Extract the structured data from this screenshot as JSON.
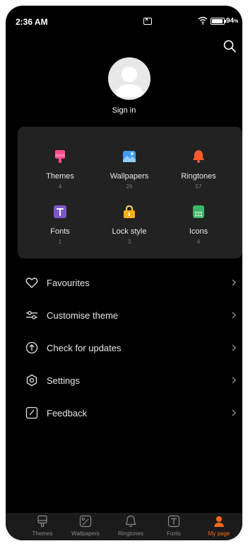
{
  "status_bar": {
    "time": "2:36 AM",
    "battery_percent": "94",
    "battery_unit": "%",
    "battery_level": 0.94
  },
  "header": {
    "search_icon": "search-icon"
  },
  "profile": {
    "avatar_icon": "user-avatar-icon",
    "sign_in_label": "Sign in"
  },
  "content_grid": [
    {
      "label": "Themes",
      "count": "4",
      "icon": "themes-icon",
      "color": "#ff4f8b"
    },
    {
      "label": "Wallpapers",
      "count": "26",
      "icon": "wallpapers-icon",
      "color": "#3f9ef0"
    },
    {
      "label": "Ringtones",
      "count": "57",
      "icon": "ringtones-icon",
      "color": "#ff5a28"
    },
    {
      "label": "Fonts",
      "count": "1",
      "icon": "fonts-icon",
      "color": "#7b57c8"
    },
    {
      "label": "Lock style",
      "count": "3",
      "icon": "lock-style-icon",
      "color": "#ffae1a"
    },
    {
      "label": "Icons",
      "count": "4",
      "icon": "icons-icon",
      "color": "#3fb56a"
    }
  ],
  "menu": [
    {
      "label": "Favourites",
      "icon": "heart-icon"
    },
    {
      "label": "Customise theme",
      "icon": "sliders-icon"
    },
    {
      "label": "Check for updates",
      "icon": "arrow-up-circle-icon"
    },
    {
      "label": "Settings",
      "icon": "settings-icon"
    },
    {
      "label": "Feedback",
      "icon": "feedback-icon"
    }
  ],
  "bottom_nav": {
    "tabs": [
      {
        "label": "Themes",
        "icon": "themes-tab-icon"
      },
      {
        "label": "Wallpapers",
        "icon": "wallpapers-tab-icon"
      },
      {
        "label": "Ringtones",
        "icon": "ringtones-tab-icon"
      },
      {
        "label": "Fonts",
        "icon": "fonts-tab-icon"
      },
      {
        "label": "My page",
        "icon": "my-page-tab-icon"
      }
    ],
    "active_index": 4,
    "active_color": "#ff6a1a"
  }
}
